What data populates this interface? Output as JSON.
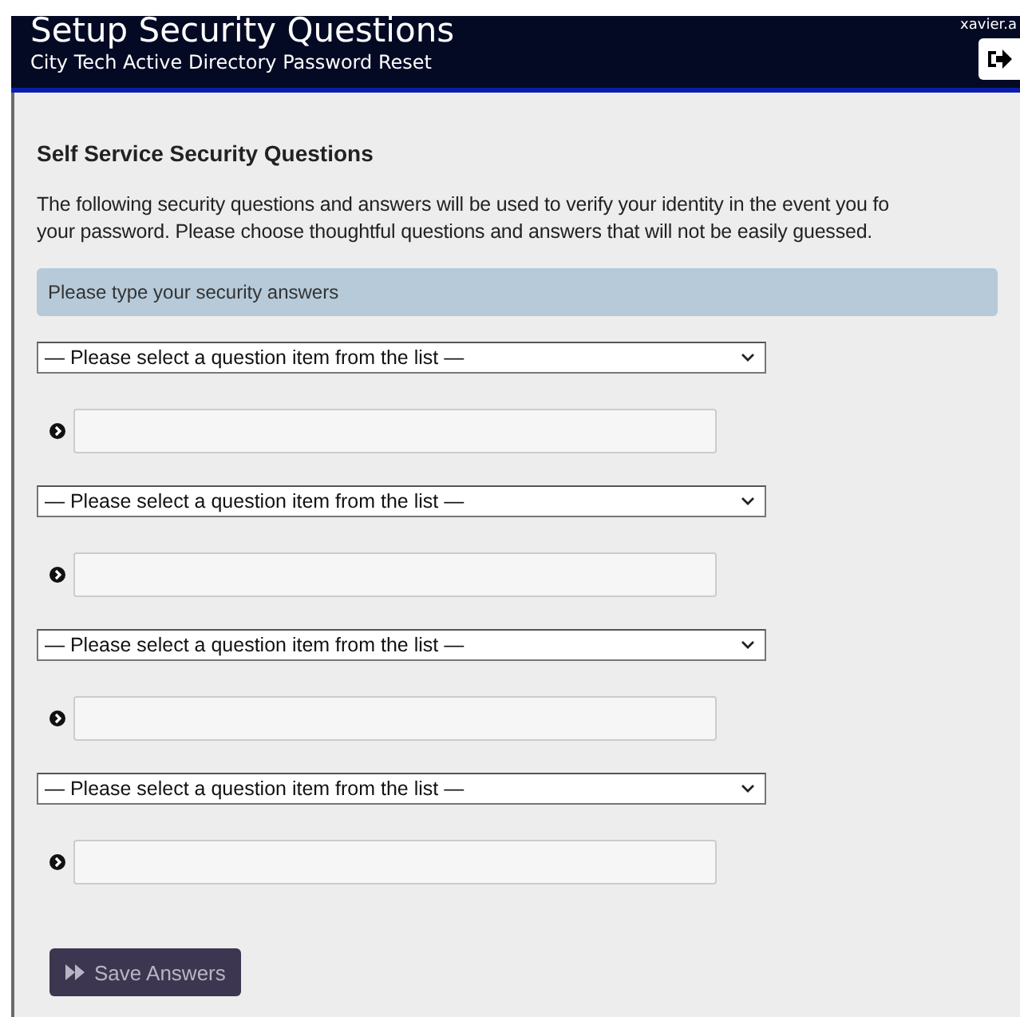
{
  "header": {
    "title": "Setup Security Questions",
    "subtitle": "City Tech Active Directory Password Reset",
    "user": "xavier.a"
  },
  "section": {
    "heading": "Self Service Security Questions",
    "description_lines": [
      "The following security questions and answers will be used to verify your identity in the event you fo",
      "your password. Please choose thoughtful questions and answers that will not be easily guessed."
    ],
    "notice": "Please type your security answers"
  },
  "questions": [
    {
      "select": "— Please select a question item from the list —"
    },
    {
      "select": "— Please select a question item from the list —"
    },
    {
      "select": "— Please select a question item from the list —"
    },
    {
      "select": "— Please select a question item from the list —"
    }
  ],
  "save_button": {
    "label": "Save Answers"
  }
}
